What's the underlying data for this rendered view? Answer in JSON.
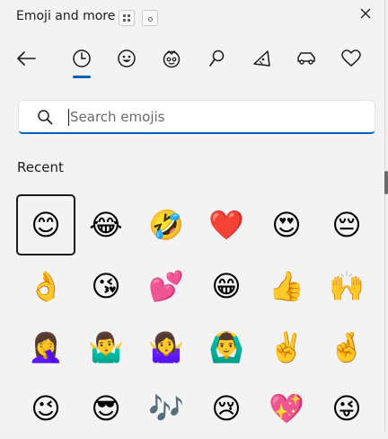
{
  "window": {
    "title": "Emoji and more",
    "close_icon": "close-icon"
  },
  "tabs": [
    {
      "name": "back",
      "icon": "back-arrow-icon"
    },
    {
      "name": "recent",
      "icon": "clock-icon",
      "selected": true
    },
    {
      "name": "emoji",
      "icon": "smiley-icon"
    },
    {
      "name": "kaomoji",
      "icon": "kaomoji-icon"
    },
    {
      "name": "symbols",
      "icon": "symbol-icon"
    },
    {
      "name": "gif",
      "icon": "gif-icon"
    },
    {
      "name": "clipboard",
      "icon": "car-icon"
    },
    {
      "name": "favorites",
      "icon": "heart-icon"
    }
  ],
  "search": {
    "placeholder": "Search emojis",
    "value": ""
  },
  "recent": {
    "label": "Recent",
    "emojis": [
      "😊",
      "😂",
      "🤣",
      "❤️",
      "😍",
      "😔",
      "👌",
      "😘",
      "💕",
      "😁",
      "👍",
      "🙌",
      "🤦‍♀️",
      "🤷‍♂️",
      "🤷‍♀️",
      "🙆‍♂️",
      "✌️",
      "🤞",
      "😉",
      "😎",
      "🎶",
      "😢",
      "💖",
      "😜"
    ]
  },
  "colors": {
    "accent": "#005fb8",
    "background": "#f3f3f3"
  }
}
